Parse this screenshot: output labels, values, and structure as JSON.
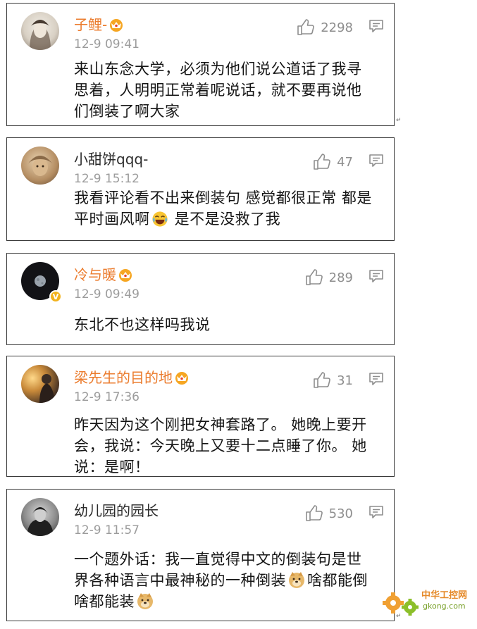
{
  "comments": [
    {
      "username": "子鲤-",
      "vip": true,
      "verified": false,
      "timestamp": "12-9 09:41",
      "likes": "2298",
      "avatar": "girl-sketch",
      "lines": [
        "来山东念大学，必须为他们说公道话了我寻",
        "思着，人明明正常着呢说话，就不要再说他",
        "们倒装了啊大家"
      ]
    },
    {
      "username": "小甜饼qqq-",
      "vip": false,
      "verified": false,
      "timestamp": "12-9 15:12",
      "likes": "47",
      "avatar": "painted-face",
      "lines": [
        "我看评论看不出来倒装句 感觉都很正常 都是"
      ],
      "line2_before_emoji": "平时画风啊",
      "line2_after_emoji": " 是不是没救了我"
    },
    {
      "username": "冷与暖",
      "vip": true,
      "verified": true,
      "timestamp": "12-9 09:49",
      "likes": "289",
      "avatar": "moon-night",
      "lines": [
        "东北不也这样吗我说"
      ]
    },
    {
      "username": "梁先生的目的地",
      "vip": true,
      "verified": false,
      "timestamp": "12-9 17:36",
      "likes": "31",
      "avatar": "sunset-portrait",
      "lines": [
        "昨天因为这个刚把女神套路了。 她晚上要开",
        "会，我说：今天晚上又要十二点睡了你。 她",
        "说：是啊！"
      ]
    },
    {
      "username": "幼儿园的园长",
      "vip": false,
      "verified": false,
      "timestamp": "12-9 11:57",
      "likes": "530",
      "avatar": "bw-portrait",
      "lines": [
        "一个题外话：我一直觉得中文的倒装句是世"
      ],
      "line2_before_emoji": "界各种语言中最神秘的一种倒装",
      "line2_after_emoji": "啥都能倒",
      "line3_before_emoji": "啥都能装"
    }
  ],
  "watermark": {
    "title": "中华工控网",
    "url": "gkong.com"
  },
  "colors": {
    "vip_name": "#eb7b2c",
    "meta": "#9c9c9c",
    "border": "#3a3a3a"
  }
}
